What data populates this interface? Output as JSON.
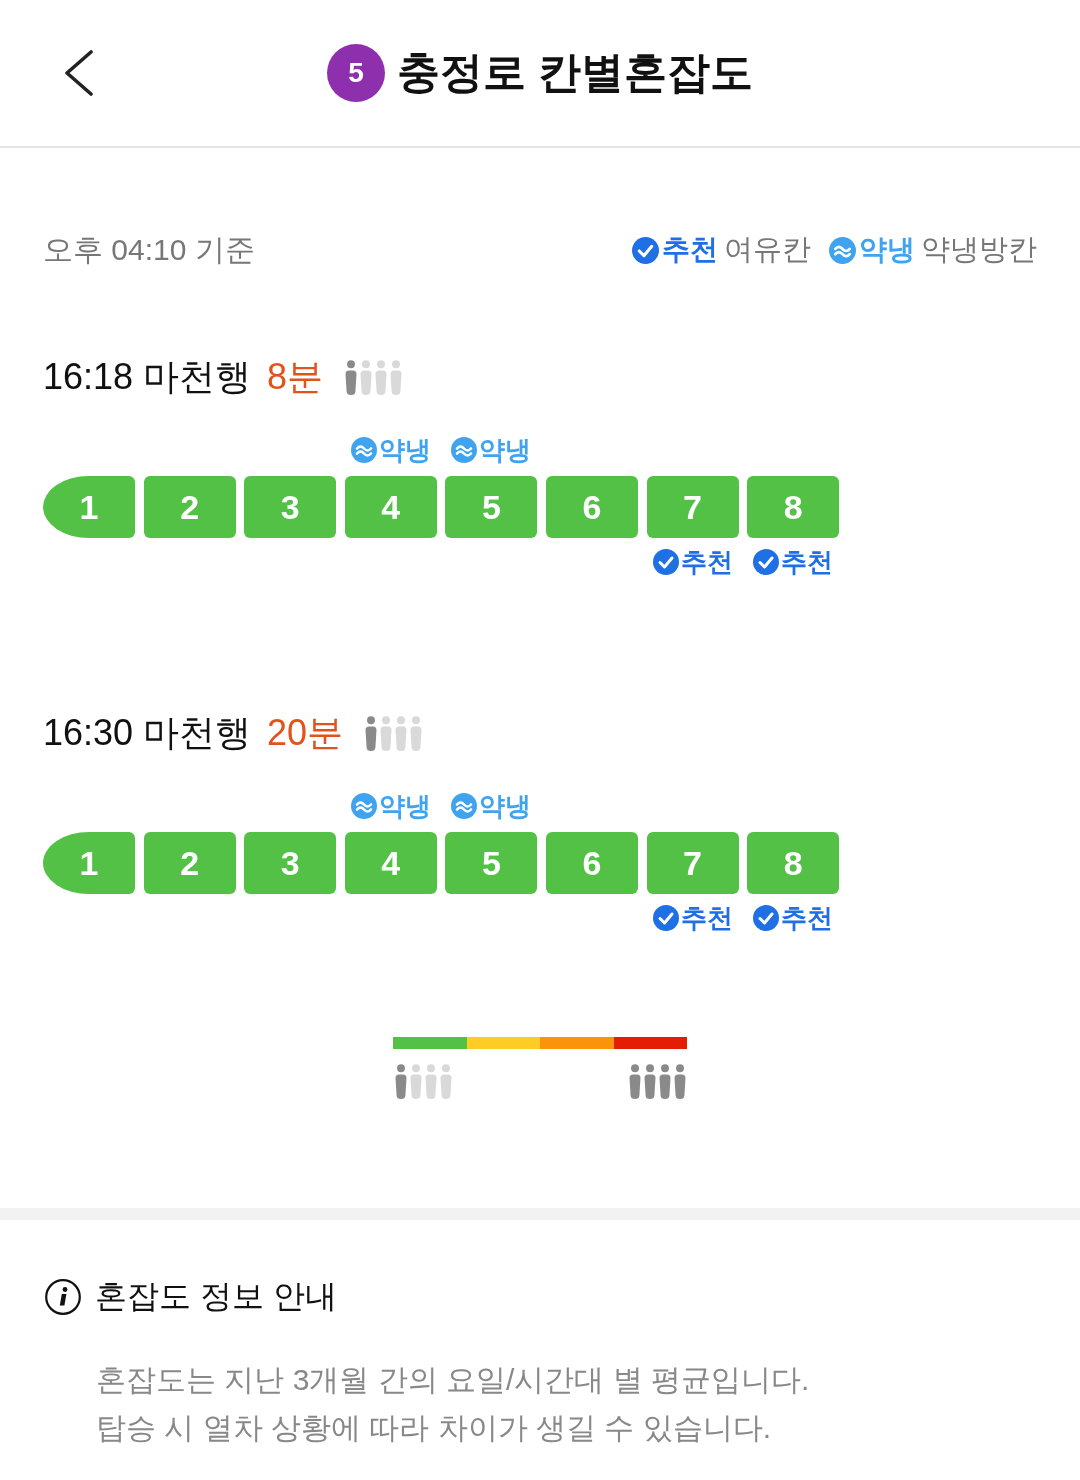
{
  "header": {
    "line": "5",
    "title": "충정로 칸별혼잡도"
  },
  "updated": "오후 04:10 기준",
  "legend": [
    {
      "kind": "recommended",
      "tag": "추천",
      "label": "여유칸"
    },
    {
      "kind": "mild_cooling",
      "tag": "약냉",
      "label": "약냉방칸"
    }
  ],
  "trains": [
    {
      "time": "16:18",
      "destination": "마천행",
      "eta": "8분",
      "crowd": [
        {
          "filled": true
        },
        {
          "filled": false
        },
        {
          "filled": false
        },
        {
          "filled": false
        }
      ],
      "cars": [
        {
          "number": "1",
          "color": "#52c146"
        },
        {
          "number": "2",
          "color": "#52c146"
        },
        {
          "number": "3",
          "color": "#52c146"
        },
        {
          "number": "4",
          "color": "#52c146",
          "tag": {
            "kind": "mild_cooling",
            "label": "약냉"
          }
        },
        {
          "number": "5",
          "color": "#52c146",
          "tag": {
            "kind": "mild_cooling",
            "label": "약냉"
          }
        },
        {
          "number": "6",
          "color": "#52c146"
        },
        {
          "number": "7",
          "color": "#52c146",
          "tag": {
            "kind": "recommended",
            "label": "추천"
          }
        },
        {
          "number": "8",
          "color": "#52c146",
          "tag": {
            "kind": "recommended",
            "label": "추천"
          }
        }
      ]
    },
    {
      "time": "16:30",
      "destination": "마천행",
      "eta": "20분",
      "crowd": [
        {
          "filled": true
        },
        {
          "filled": false
        },
        {
          "filled": false
        },
        {
          "filled": false
        }
      ],
      "cars": [
        {
          "number": "1",
          "color": "#52c146"
        },
        {
          "number": "2",
          "color": "#52c146"
        },
        {
          "number": "3",
          "color": "#52c146"
        },
        {
          "number": "4",
          "color": "#52c146",
          "tag": {
            "kind": "mild_cooling",
            "label": "약냉"
          }
        },
        {
          "number": "5",
          "color": "#52c146",
          "tag": {
            "kind": "mild_cooling",
            "label": "약냉"
          }
        },
        {
          "number": "6",
          "color": "#52c146"
        },
        {
          "number": "7",
          "color": "#52c146",
          "tag": {
            "kind": "recommended",
            "label": "추천"
          }
        },
        {
          "number": "8",
          "color": "#52c146",
          "tag": {
            "kind": "recommended",
            "label": "추천"
          }
        }
      ]
    }
  ],
  "scale": {
    "segments": [
      {
        "color": "#52c146"
      },
      {
        "color": "#fdcd25"
      },
      {
        "color": "#fb9409"
      },
      {
        "color": "#e31e05"
      }
    ],
    "low": [
      {
        "filled": true
      },
      {
        "filled": false
      },
      {
        "filled": false
      },
      {
        "filled": false
      }
    ],
    "high": [
      {
        "filled": true
      },
      {
        "filled": true
      },
      {
        "filled": true
      },
      {
        "filled": true
      }
    ]
  },
  "info": {
    "title": "혼잡도 정보 안내",
    "lines": [
      "혼잡도는 지난 3개월 간의 요일/시간대 별 평균입니다.",
      "탑승 시 열차 상황에 따라 차이가 생길 수 있습니다."
    ]
  }
}
